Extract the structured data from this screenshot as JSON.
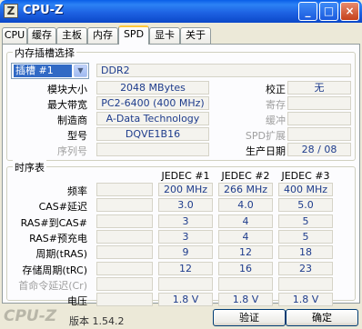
{
  "window": {
    "title": "CPU-Z",
    "icon_letter": "Z",
    "controls": {
      "minimize": "_",
      "maximize": "□",
      "close": "×"
    }
  },
  "tabs": [
    "CPU",
    "缓存",
    "主板",
    "内存",
    "SPD",
    "显卡",
    "关于"
  ],
  "active_tab": "SPD",
  "slot": {
    "group_title": "内存插槽选择",
    "selected_slot": "插槽 #1",
    "memory_type": "DDR2",
    "labels": {
      "module_size": "模块大小",
      "max_bandwidth": "最大带宽",
      "manufacturer": "制造商",
      "part_number": "型号",
      "serial_number": "序列号",
      "correction": "校正",
      "registered": "寄存",
      "buffered": "缓冲",
      "spd_ext": "SPD扩展",
      "week_year": "生产日期"
    },
    "values": {
      "module_size": "2048 MBytes",
      "max_bandwidth": "PC2-6400 (400 MHz)",
      "manufacturer": "A-Data Technology",
      "part_number": "DQVE1B16",
      "serial_number": "",
      "correction": "无",
      "registered": "",
      "buffered": "",
      "spd_ext": "",
      "week_year": "28 / 08"
    }
  },
  "timings": {
    "group_title": "时序表",
    "columns": [
      "JEDEC #1",
      "JEDEC #2",
      "JEDEC #3"
    ],
    "rows": [
      {
        "label": "频率",
        "values": [
          "200 MHz",
          "266 MHz",
          "400 MHz"
        ],
        "gray": false
      },
      {
        "label": "CAS#延迟",
        "values": [
          "3.0",
          "4.0",
          "5.0"
        ],
        "gray": false
      },
      {
        "label": "RAS#到CAS#",
        "values": [
          "3",
          "4",
          "5"
        ],
        "gray": false
      },
      {
        "label": "RAS#预充电",
        "values": [
          "3",
          "4",
          "5"
        ],
        "gray": false
      },
      {
        "label": "周期(tRAS)",
        "values": [
          "9",
          "12",
          "18"
        ],
        "gray": false
      },
      {
        "label": "存储周期(tRC)",
        "values": [
          "12",
          "16",
          "23"
        ],
        "gray": false
      },
      {
        "label": "首命令延迟(Cr)",
        "values": [
          "",
          "",
          ""
        ],
        "gray": true
      },
      {
        "label": "电压",
        "values": [
          "1.8 V",
          "1.8 V",
          "1.8 V"
        ],
        "gray": false
      }
    ]
  },
  "footer": {
    "logo": "CPU-Z",
    "version": "版本 1.54.2",
    "validate_button": "验证",
    "ok_button": "确定"
  }
}
